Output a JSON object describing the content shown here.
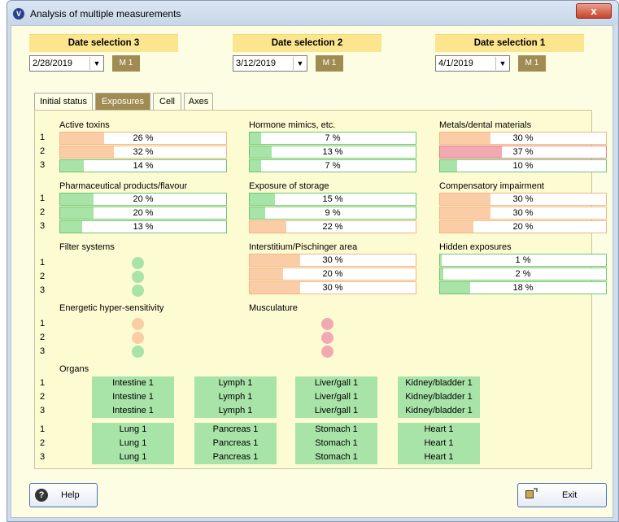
{
  "window": {
    "title": "Analysis of multiple measurements",
    "close": "x"
  },
  "dates": [
    {
      "header": "Date selection 3",
      "value": "2/28/2019",
      "m": "M 1"
    },
    {
      "header": "Date selection 2",
      "value": "3/12/2019",
      "m": "M 1"
    },
    {
      "header": "Date selection 1",
      "value": "4/1/2019",
      "m": "M 1"
    }
  ],
  "tabs": [
    "Initial status",
    "Exposures",
    "Cell",
    "Axes"
  ],
  "row_labels": [
    "1",
    "2",
    "3"
  ],
  "sections": {
    "active_toxins": {
      "title": "Active toxins",
      "values": [
        "26 %",
        "32 %",
        "14 %"
      ],
      "levels": [
        26,
        32,
        14
      ],
      "colors": [
        "orange",
        "orange",
        "green"
      ]
    },
    "hormone": {
      "title": "Hormone mimics, etc.",
      "values": [
        "7 %",
        "13 %",
        "7 %"
      ],
      "levels": [
        7,
        13,
        7
      ],
      "colors": [
        "green",
        "green",
        "green"
      ]
    },
    "metals": {
      "title": "Metals/dental materials",
      "values": [
        "30 %",
        "37 %",
        "10 %"
      ],
      "levels": [
        30,
        37,
        10
      ],
      "colors": [
        "orange",
        "red",
        "green"
      ]
    },
    "pharma": {
      "title": "Pharmaceutical products/flavour",
      "values": [
        "20 %",
        "20 %",
        "13 %"
      ],
      "levels": [
        20,
        20,
        13
      ],
      "colors": [
        "green",
        "green",
        "green"
      ]
    },
    "storage": {
      "title": "Exposure of storage",
      "values": [
        "15 %",
        "9 %",
        "22 %"
      ],
      "levels": [
        15,
        9,
        22
      ],
      "colors": [
        "green",
        "green",
        "orange"
      ]
    },
    "compensatory": {
      "title": "Compensatory impairment",
      "values": [
        "30 %",
        "30 %",
        "20 %"
      ],
      "levels": [
        30,
        30,
        20
      ],
      "colors": [
        "orange",
        "orange",
        "orange"
      ]
    },
    "interstitium": {
      "title": "Interstitium/Pischinger area",
      "values": [
        "30 %",
        "20 %",
        "30 %"
      ],
      "levels": [
        30,
        20,
        30
      ],
      "colors": [
        "orange",
        "orange",
        "orange"
      ]
    },
    "hidden": {
      "title": "Hidden exposures",
      "values": [
        "1 %",
        "2 %",
        "18 %"
      ],
      "levels": [
        1,
        2,
        18
      ],
      "colors": [
        "green",
        "green",
        "green"
      ]
    }
  },
  "filter_systems": {
    "title": "Filter systems",
    "dots": [
      "green",
      "green",
      "green"
    ]
  },
  "energetic": {
    "title": "Energetic hyper-sensitivity",
    "dots": [
      "orange",
      "orange",
      "green"
    ]
  },
  "musculature": {
    "title": "Musculature",
    "dots": [
      "pink",
      "pink",
      "pink"
    ]
  },
  "organs": {
    "title": "Organs",
    "group1": [
      "Intestine 1",
      "Lymph 1",
      "Liver/gall 1",
      "Kidney/bladder 1"
    ],
    "group2": [
      "Lung 1",
      "Pancreas 1",
      "Stomach 1",
      "Heart 1"
    ]
  },
  "buttons": {
    "help": "Help",
    "exit": "Exit"
  },
  "colors": {
    "green": "#a8e3a8",
    "orange": "#fbcda6",
    "red": "#f2aab2",
    "gold": "#a08c52",
    "header": "#fbe68f"
  }
}
